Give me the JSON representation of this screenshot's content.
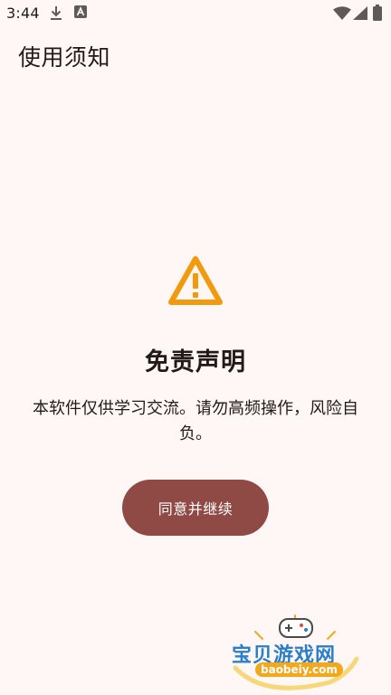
{
  "status_bar": {
    "time": "3:44",
    "icons": [
      "download-icon",
      "a-notification-icon",
      "wifi-icon",
      "cell-signal-icon",
      "battery-icon"
    ]
  },
  "app_bar": {
    "title": "使用须知"
  },
  "dialog": {
    "icon": "warning-icon",
    "title": "免责声明",
    "body": "本软件仅供学习交流。请勿高频操作，风险自负。",
    "button_label": "同意并继续"
  },
  "watermark": {
    "title": "宝贝游戏网",
    "url": "baobeiy.com"
  },
  "colors": {
    "background": "#FFF7F5",
    "text": "#231918",
    "warning": "#F29A0E",
    "button": "#8F4A46",
    "button_text": "#FFFFFF"
  }
}
